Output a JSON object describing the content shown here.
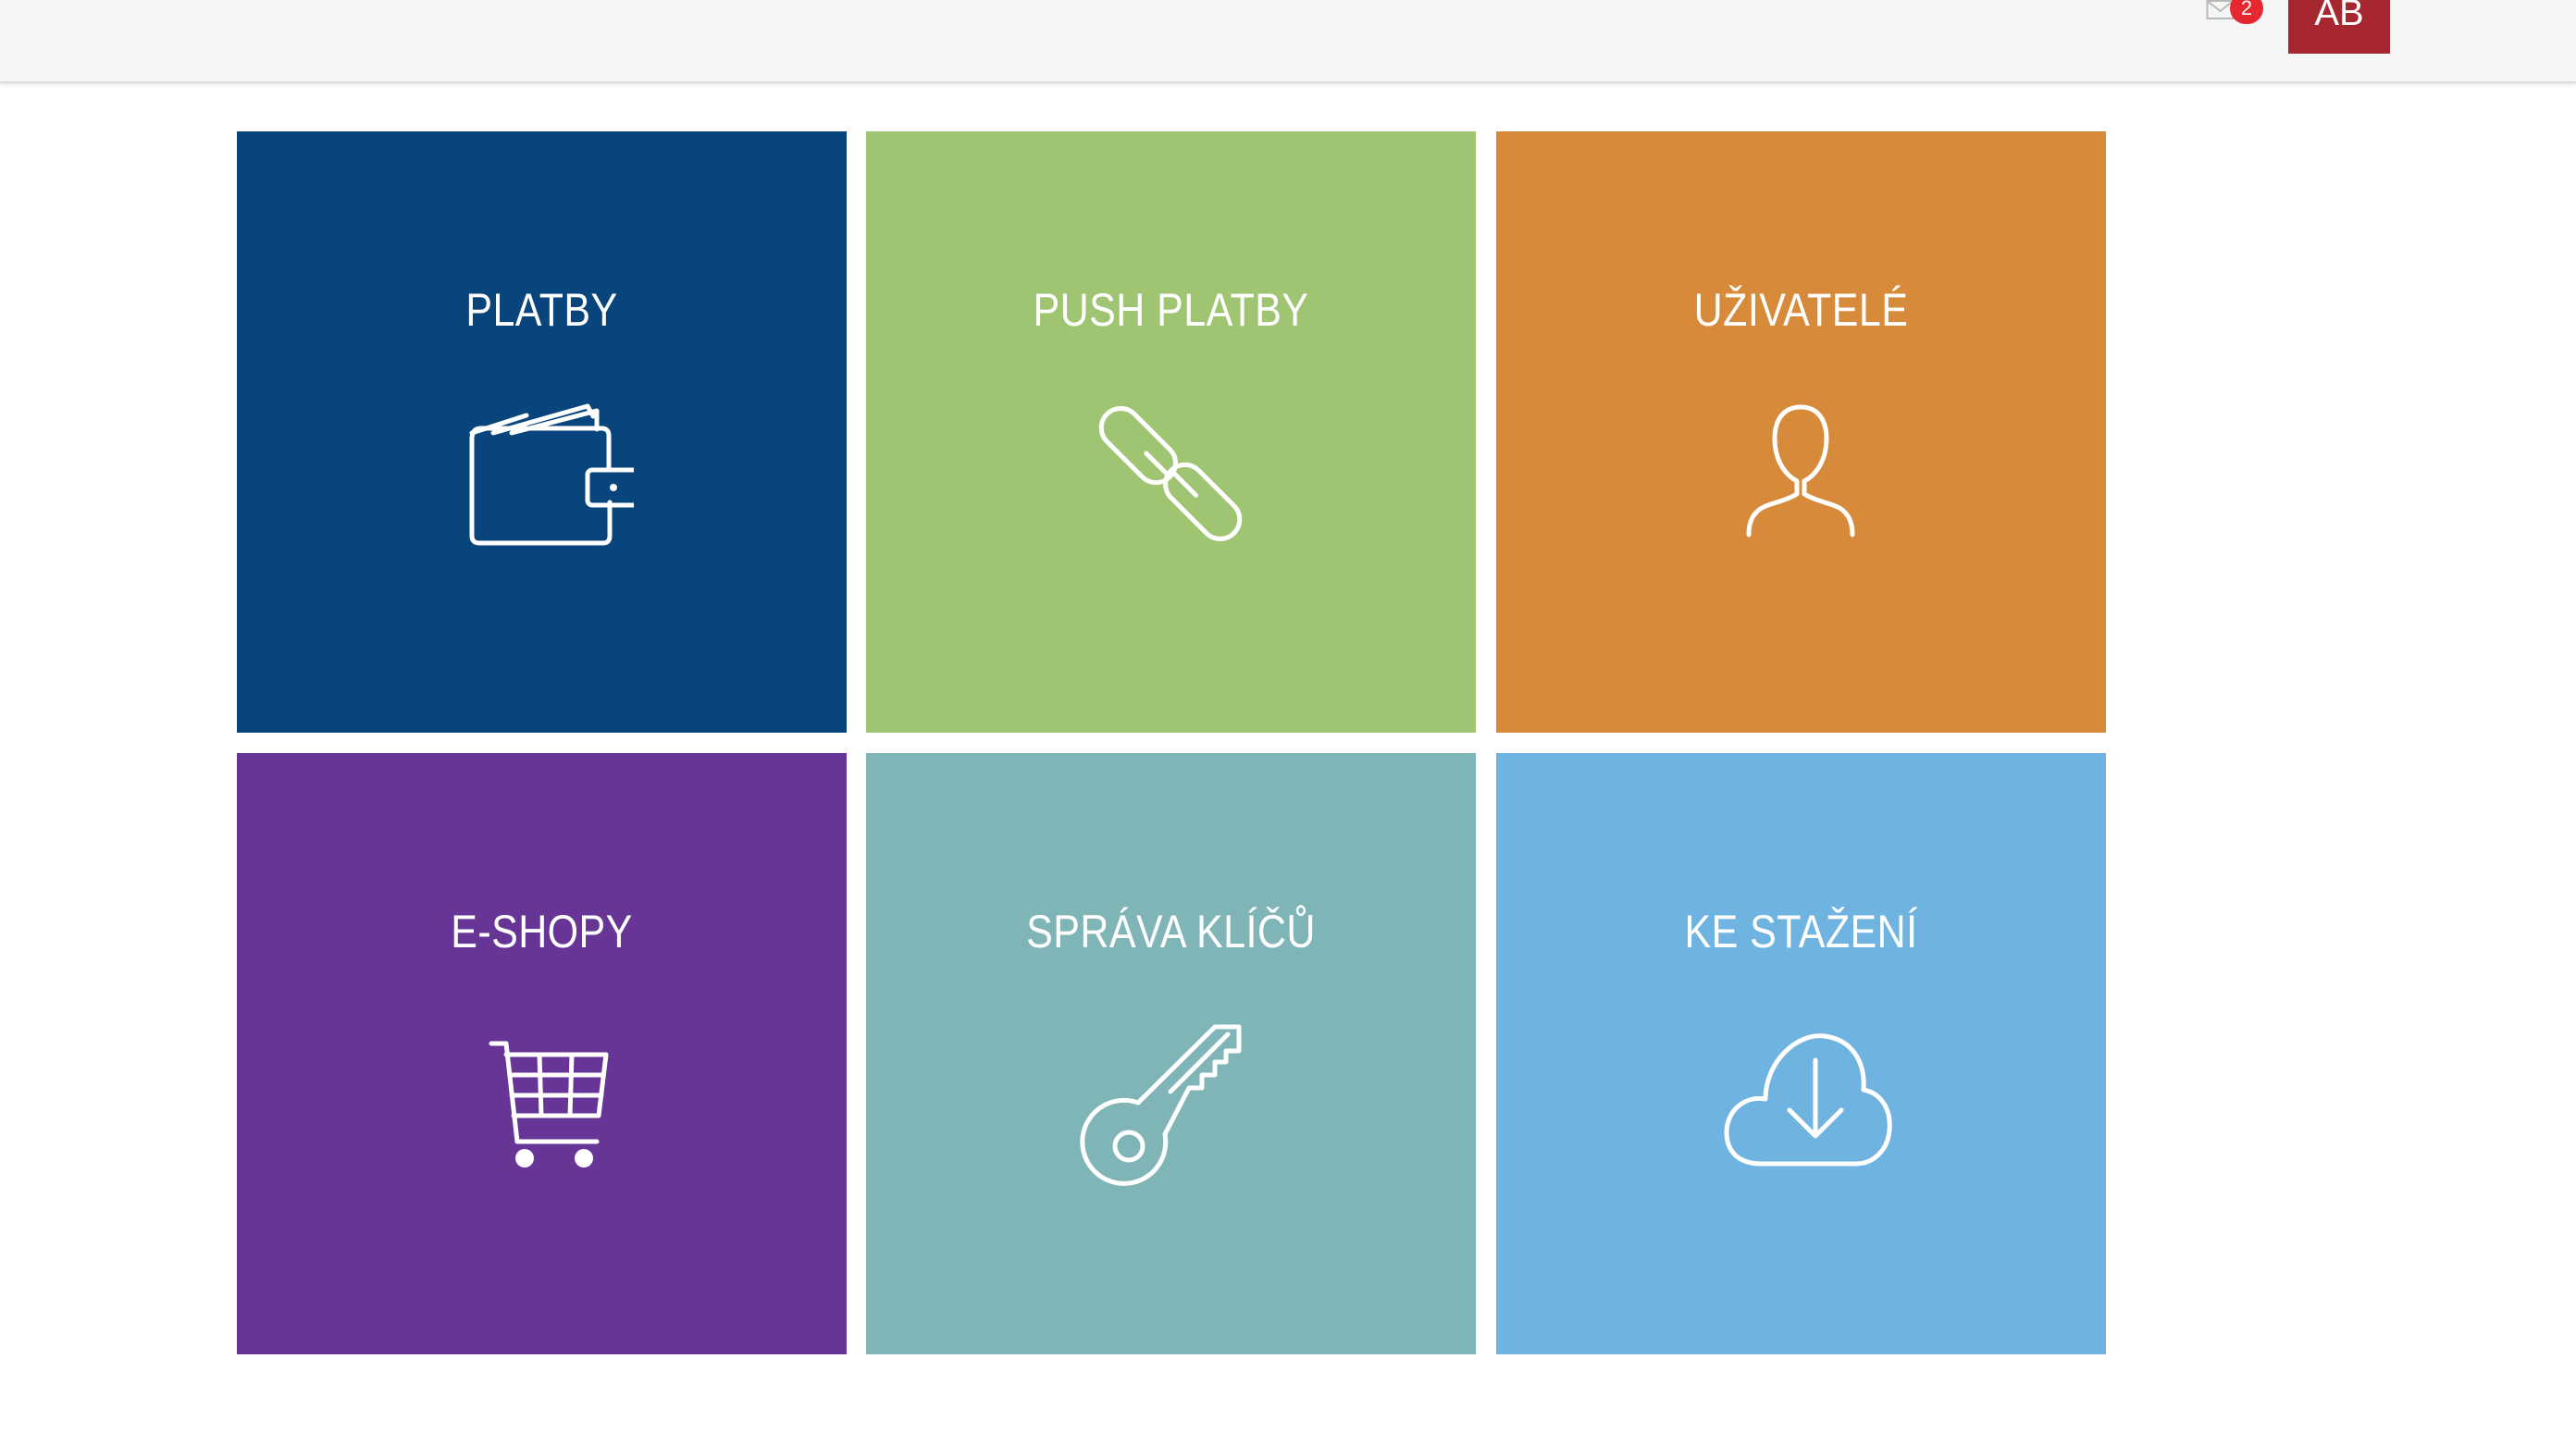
{
  "header": {
    "mail_icon": "envelope-icon",
    "mail_badge": "2",
    "user_initials": "AB",
    "user_color": "#a6272f",
    "badge_color": "#e7272f"
  },
  "tiles": [
    {
      "label": "PLATBY",
      "icon": "wallet-icon",
      "color": "#08457c"
    },
    {
      "label": "PUSH PLATBY",
      "icon": "link-icon",
      "color": "#a0c572"
    },
    {
      "label": "UŽIVATELÉ",
      "icon": "user-icon",
      "color": "#d78a3a"
    },
    {
      "label": "E-SHOPY",
      "icon": "cart-icon",
      "color": "#663595"
    },
    {
      "label": "SPRÁVA KLÍČŮ",
      "icon": "key-icon",
      "color": "#80b5b7"
    },
    {
      "label": "KE STAŽENÍ",
      "icon": "cloud-download-icon",
      "color": "#6fb4e1"
    }
  ]
}
